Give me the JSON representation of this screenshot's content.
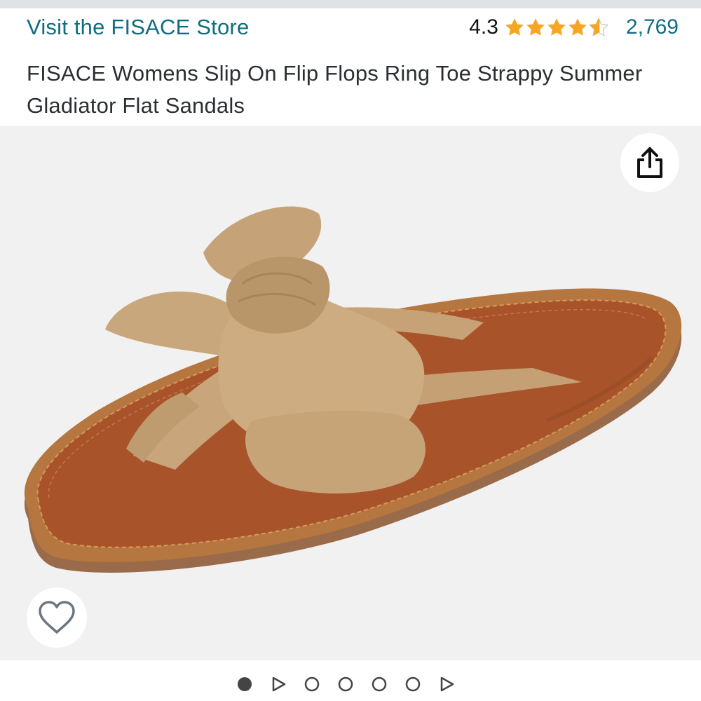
{
  "header": {
    "store_link": "Visit the FISACE Store",
    "rating_value": "4.3",
    "rating_fraction": 0.86,
    "rating_count": "2,769",
    "star_color": "#f6a623"
  },
  "product": {
    "title": "FISACE Womens Slip On Flip Flops Ring Toe Strappy Summer Gladiator Flat Sandals"
  },
  "gallery": {
    "image_subject": "tan suede bow flip-flop sandal with brown footbed",
    "share_icon": "share-icon",
    "wishlist_icon": "heart-outline-icon",
    "pagination": [
      {
        "type": "image",
        "active": true
      },
      {
        "type": "video",
        "active": false
      },
      {
        "type": "image",
        "active": false
      },
      {
        "type": "image",
        "active": false
      },
      {
        "type": "image",
        "active": false
      },
      {
        "type": "image",
        "active": false
      },
      {
        "type": "video",
        "active": false
      }
    ]
  },
  "colors": {
    "link": "#0f6c81",
    "text": "#2b2f32",
    "image_bg": "#f1f1f1"
  }
}
